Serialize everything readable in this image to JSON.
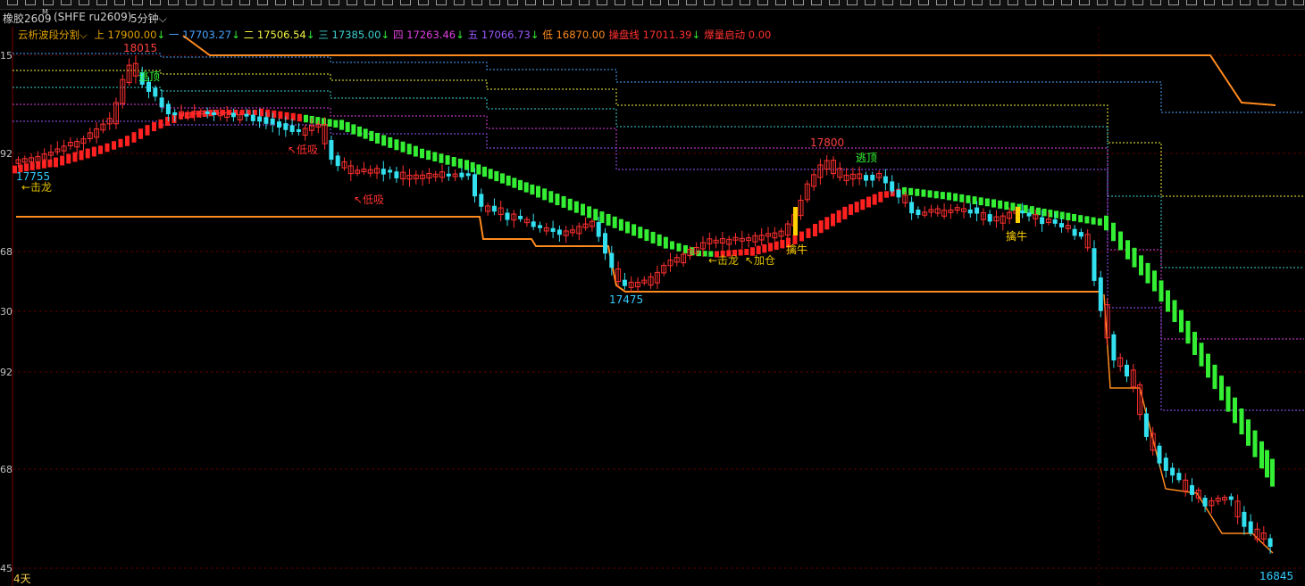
{
  "app": {
    "instrument_name": "橡胶2609",
    "instrument_flag": "M",
    "instrument_code": "(SHFE ru2609)",
    "period": "5分钟",
    "bottom_label": "4天"
  },
  "legend": {
    "indicator_name": "云析波段分割",
    "items": [
      {
        "label": "上",
        "value": "17900.00",
        "arrow": "↓",
        "color": "#e0a000"
      },
      {
        "label": "一",
        "value": "17703.27",
        "arrow": "↓",
        "color": "#4aa3ff"
      },
      {
        "label": "二",
        "value": "17506.54",
        "arrow": "↓",
        "color": "#f5f542"
      },
      {
        "label": "三",
        "value": "17385.00",
        "arrow": "↓",
        "color": "#3ed0d0"
      },
      {
        "label": "四",
        "value": "17263.46",
        "arrow": "↓",
        "color": "#e040e0"
      },
      {
        "label": "五",
        "value": "17066.73",
        "arrow": "↓",
        "color": "#9b59ff"
      },
      {
        "label": "低",
        "value": "16870.00",
        "arrow": "",
        "color": "#ff8a1e"
      },
      {
        "label": "操盘线",
        "value": "17011.39",
        "arrow": "↓",
        "color": "#ff3030"
      },
      {
        "label": "爆量启动",
        "value": "0.00",
        "arrow": "",
        "color": "#ff3030"
      }
    ]
  },
  "y_axis_labels": [
    "15",
    "92",
    "68",
    "30",
    "92",
    "68",
    "45"
  ],
  "annotations": [
    {
      "text": "18015",
      "color": "#ff4040"
    },
    {
      "text": "逃顶",
      "color": "#33ff33"
    },
    {
      "text": "17755",
      "color": "#33ccff"
    },
    {
      "text": "←击龙",
      "color": "#e0c000"
    },
    {
      "text": "↖低吸",
      "color": "#ff3030"
    },
    {
      "text": "↖低吸",
      "color": "#ff3030"
    },
    {
      "text": "17800",
      "color": "#ff4040"
    },
    {
      "text": "逃顶",
      "color": "#33ff33"
    },
    {
      "text": "17475",
      "color": "#33ccff"
    },
    {
      "text": "←击龙",
      "color": "#e0c000"
    },
    {
      "text": "↖加仓",
      "color": "#e0c000"
    },
    {
      "text": "擒牛",
      "color": "#ffd000"
    },
    {
      "text": "擒牛",
      "color": "#ffd000"
    },
    {
      "text": "16845",
      "color": "#33ccff"
    }
  ],
  "colors": {
    "up_candle": "#ff3030",
    "down_candle": "#33e0f0",
    "band_bull": "#ff2020",
    "band_bear": "#33ee33",
    "stop_line": "#ff8a1e",
    "grid": "#5a0000"
  }
}
